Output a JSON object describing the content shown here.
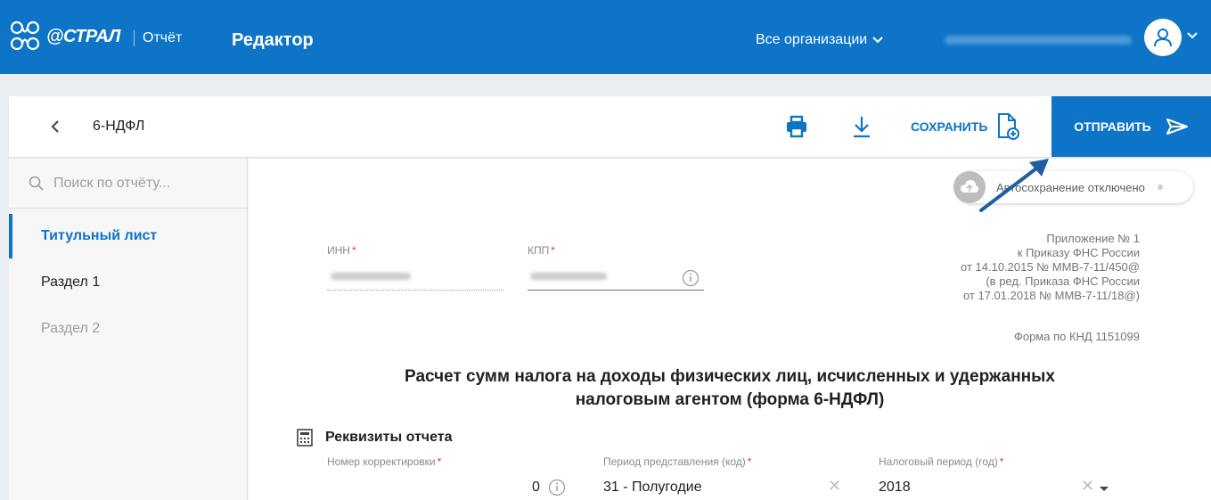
{
  "header": {
    "logo_text": "@СТРАЛ",
    "logo_sub": "Отчёт",
    "app_title": "Редактор",
    "org_select": "Все организации"
  },
  "actionbar": {
    "report_name": "6-НДФЛ",
    "save_label": "СОХРАНИТЬ",
    "send_label": "ОТПРАВИТЬ"
  },
  "sidebar": {
    "search_placeholder": "Поиск по отчёту...",
    "items": [
      {
        "label": "Титульный лист",
        "state": "active"
      },
      {
        "label": "Раздел 1",
        "state": "normal"
      },
      {
        "label": "Раздел 2",
        "state": "disabled"
      }
    ]
  },
  "main": {
    "autosave": "Автосохранение отключено",
    "inn_label": "ИНН",
    "kpp_label": "КПП",
    "appendix": [
      "Приложение № 1",
      "к Приказу ФНС России",
      "от 14.10.2015 № ММВ-7-11/450@",
      "(в ред. Приказа ФНС России",
      "от 17.01.2018 № ММВ-7-11/18@)"
    ],
    "form_knd": "Форма по КНД 1151099",
    "title_line1": "Расчет сумм налога на доходы физических лиц, исчисленных и удержанных",
    "title_line2": "налоговым агентом (форма 6-НДФЛ)",
    "section_title": "Реквизиты отчета",
    "correction_label": "Номер корректировки",
    "correction_value": "0",
    "period_label": "Период представления (код)",
    "period_value": "31 - Полугодие",
    "tax_year_label": "Налоговый период (год)",
    "tax_year_value": "2018",
    "required_mark": "*"
  },
  "colors": {
    "brand": "#0d74c7",
    "required": "#e53935",
    "annotation_arrow": "#1f5fa0"
  }
}
